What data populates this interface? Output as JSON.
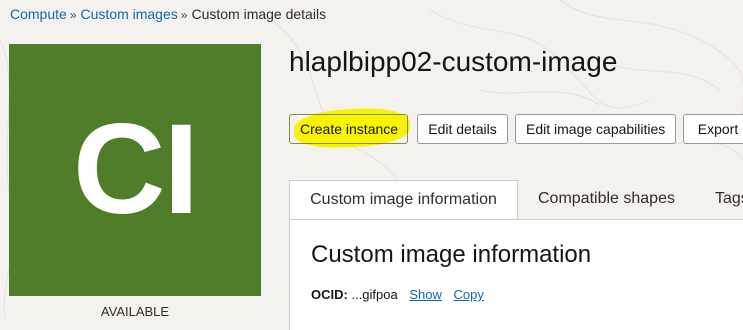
{
  "breadcrumb": {
    "items": [
      "Compute",
      "Custom images"
    ],
    "current": "Custom image details",
    "separator": "»"
  },
  "image_tile": {
    "initials": "CI",
    "color": "#507d2a",
    "status": "AVAILABLE"
  },
  "title": "hlaplbipp02-custom-image",
  "actions": {
    "create_instance": "Create instance",
    "edit_details": "Edit details",
    "edit_capabilities": "Edit image capabilities",
    "export": "Export"
  },
  "tabs": [
    {
      "label": "Custom image information",
      "active": true
    },
    {
      "label": "Compatible shapes",
      "active": false
    },
    {
      "label": "Tags",
      "active": false
    }
  ],
  "panel": {
    "heading": "Custom image information",
    "ocid_label": "OCID:",
    "ocid_value": "...gifpoa",
    "show_link": "Show",
    "copy_link": "Copy"
  },
  "colors": {
    "link": "#1566a8",
    "highlight": "#f6f400",
    "background": "#f3f2ef"
  }
}
